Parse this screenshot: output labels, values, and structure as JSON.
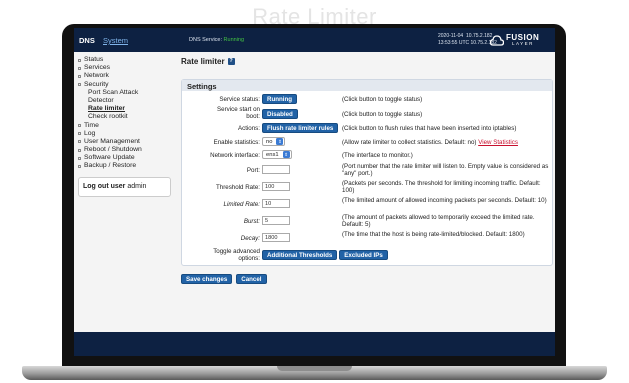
{
  "heading": "Rate Limiter",
  "topbar": {
    "brand": "DNS",
    "system_link": "System",
    "service_prefix": "DNS Service:",
    "service_status": "Running",
    "date": "2020-11-04",
    "time": "13:53:55 UTC",
    "ip1": "10.75.2.182",
    "ip2": "10.75.2.182",
    "logo_word1": "FUSION",
    "logo_word2": "LAYER"
  },
  "sidebar": {
    "items": [
      {
        "label": "Status"
      },
      {
        "label": "Services"
      },
      {
        "label": "Network"
      },
      {
        "label": "Security"
      }
    ],
    "security_sub": [
      {
        "label": "Port Scan Attack"
      },
      {
        "label": "Detector"
      },
      {
        "label": "Rate limiter"
      },
      {
        "label": "Check rootkit"
      }
    ],
    "items2": [
      {
        "label": "Time"
      },
      {
        "label": "Log"
      },
      {
        "label": "User Management"
      },
      {
        "label": "Reboot / Shutdown"
      },
      {
        "label": "Software Update"
      },
      {
        "label": "Backup / Restore"
      }
    ],
    "logout_label": "Log out user",
    "logout_user": "admin"
  },
  "main": {
    "title": "Rate limiter",
    "help_icon": "?",
    "settings_title": "Settings",
    "rows": {
      "service_status": {
        "label": "Service status:",
        "button": "Running",
        "desc": "(Click button to toggle status)"
      },
      "service_boot": {
        "label1": "Service start on",
        "label2": "boot:",
        "button": "Disabled",
        "desc": "(Click button to toggle status)"
      },
      "actions": {
        "label": "Actions:",
        "button": "Flush rate limiter rules",
        "desc": "(Click button to flush rules that have been inserted into iptables)"
      },
      "enable_stats": {
        "label": "Enable statistics:",
        "value": "no",
        "desc": "(Allow rate limiter to collect statistics. Default: no)",
        "link": "View Statistics"
      },
      "interface": {
        "label": "Network interface:",
        "value": "ens1",
        "desc": "(The interface to monitor.)"
      },
      "port": {
        "label": "Port:",
        "value": "",
        "desc": "(Port number that the rate limiter will listen to. Empty value is considered as \"any\" port.)"
      },
      "threshold": {
        "label": "Threshold Rate:",
        "value": "100",
        "desc": "(Packets per seconds. The threshold for limiting incoming traffic. Default: 100)"
      },
      "limited": {
        "label": "Limited Rate:",
        "value": "10",
        "desc": "(The limited amount of allowed incoming packets per seconds. Default: 10)"
      },
      "burst": {
        "label": "Burst:",
        "value": "5",
        "desc": "(The amount of packets allowed to temporarily exceed the limited rate. Default: 5)"
      },
      "decay": {
        "label": "Decay:",
        "value": "1800",
        "desc": "(The time that the host is being rate-limited/blocked. Default: 1800)"
      },
      "advanced": {
        "label1": "Toggle advanced",
        "label2": "options:",
        "button1": "Additional Thresholds",
        "button2": "Excluded IPs"
      }
    },
    "save_button": "Save changes",
    "cancel_button": "Cancel"
  }
}
